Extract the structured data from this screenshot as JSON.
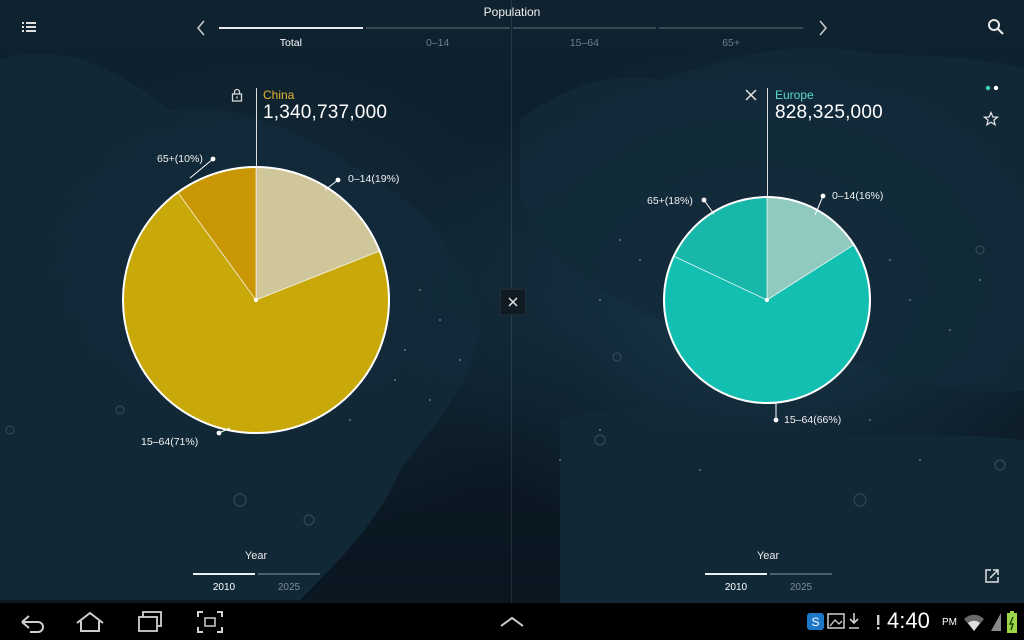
{
  "header": {
    "title": "Population",
    "tabs": [
      {
        "label": "Total",
        "active": true
      },
      {
        "label": "0–14",
        "active": false
      },
      {
        "label": "15–64",
        "active": false
      },
      {
        "label": "65+",
        "active": false
      }
    ]
  },
  "icons": {
    "menu": "list-menu-icon",
    "search": "search-icon",
    "prev": "chevron-left-icon",
    "next": "chevron-right-icon",
    "view_toggle": "dots-icon",
    "favorite": "star-icon",
    "lock": "lock-icon",
    "close": "close-icon",
    "share": "share-icon"
  },
  "left_panel": {
    "region": "China",
    "population": "1,340,737,000",
    "slices": [
      {
        "label": "0–14(19%)",
        "value": 19
      },
      {
        "label": "15–64(71%)",
        "value": 71
      },
      {
        "label": "65+(10%)",
        "value": 10
      }
    ],
    "year_title": "Year",
    "years": [
      {
        "label": "2010",
        "active": true
      },
      {
        "label": "2025",
        "active": false
      }
    ]
  },
  "right_panel": {
    "region": "Europe",
    "population": "828,325,000",
    "slices": [
      {
        "label": "0–14(16%)",
        "value": 16
      },
      {
        "label": "15–64(66%)",
        "value": 66
      },
      {
        "label": "65+(18%)",
        "value": 18
      }
    ],
    "year_title": "Year",
    "years": [
      {
        "label": "2010",
        "active": true
      },
      {
        "label": "2025",
        "active": false
      }
    ]
  },
  "colors": {
    "china_region_name": "#e6b432",
    "europe_region_name": "#5ed8c8",
    "china_pie_main": "#c9a80a",
    "china_pie_young": "#cfc79a",
    "china_pie_old": "#c99706",
    "europe_pie_main": "#12bfb0",
    "europe_pie_young": "#8fc9bf",
    "europe_pie_old": "#18b7aa"
  },
  "status_bar": {
    "time": "4:40",
    "ampm": "PM"
  },
  "chart_data": [
    {
      "type": "pie",
      "title": "China",
      "categories": [
        "0–14",
        "15–64",
        "65+"
      ],
      "values": [
        19,
        71,
        10
      ]
    },
    {
      "type": "pie",
      "title": "Europe",
      "categories": [
        "0–14",
        "15–64",
        "65+"
      ],
      "values": [
        16,
        66,
        18
      ]
    }
  ]
}
